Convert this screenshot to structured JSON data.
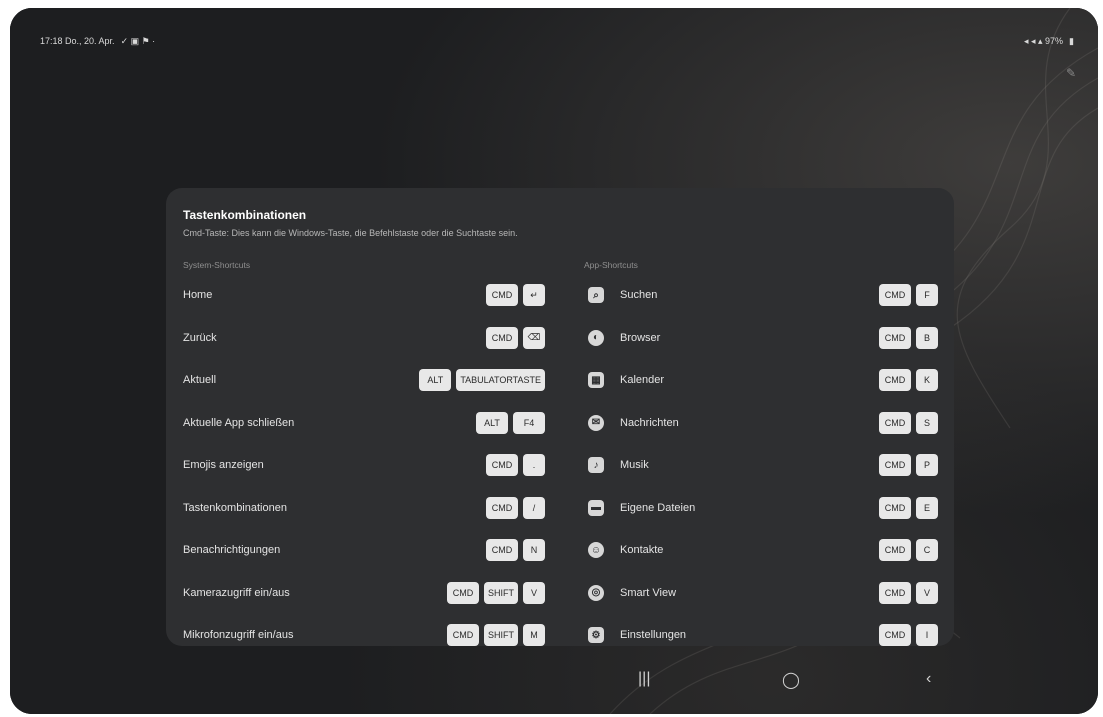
{
  "statusbar": {
    "time_date": "17:18 Do., 20. Apr.",
    "left_icons": "✓ ▣ ⚑ ·",
    "right_icons": "◂ ◂ ▴ 97%",
    "battery": "▮"
  },
  "dialog": {
    "title": "Tastenkombinationen",
    "subtitle": "Cmd-Taste: Dies kann die Windows-Taste, die Befehlstaste oder die Suchtaste sein.",
    "left_header": "System-Shortcuts",
    "right_header": "App-Shortcuts",
    "left_items": [
      {
        "label": "Home",
        "keys": [
          "CMD",
          "↵"
        ]
      },
      {
        "label": "Zurück",
        "keys": [
          "CMD",
          "⌫"
        ]
      },
      {
        "label": "Aktuell",
        "keys": [
          "ALT",
          "TABULATORTASTE"
        ]
      },
      {
        "label": "Aktuelle App schließen",
        "keys": [
          "ALT",
          "F4"
        ]
      },
      {
        "label": "Emojis anzeigen",
        "keys": [
          "CMD",
          "."
        ]
      },
      {
        "label": "Tastenkombinationen",
        "keys": [
          "CMD",
          "/"
        ]
      },
      {
        "label": "Benachrichtigungen",
        "keys": [
          "CMD",
          "N"
        ]
      },
      {
        "label": "Kamerazugriff ein/aus",
        "keys": [
          "CMD",
          "SHIFT",
          "V"
        ]
      },
      {
        "label": "Mikrofonzugriff ein/aus",
        "keys": [
          "CMD",
          "SHIFT",
          "M"
        ]
      }
    ],
    "right_items": [
      {
        "label": "Suchen",
        "icon": "search-app-icon",
        "glyph": "⌕",
        "keys": [
          "CMD",
          "F"
        ]
      },
      {
        "label": "Browser",
        "icon": "browser-app-icon",
        "glyph": "◐",
        "keys": [
          "CMD",
          "B"
        ]
      },
      {
        "label": "Kalender",
        "icon": "calendar-app-icon",
        "glyph": "▦",
        "keys": [
          "CMD",
          "K"
        ]
      },
      {
        "label": "Nachrichten",
        "icon": "messages-app-icon",
        "glyph": "✉",
        "keys": [
          "CMD",
          "S"
        ]
      },
      {
        "label": "Musik",
        "icon": "music-app-icon",
        "glyph": "♪",
        "keys": [
          "CMD",
          "P"
        ]
      },
      {
        "label": "Eigene Dateien",
        "icon": "files-app-icon",
        "glyph": "▬",
        "keys": [
          "CMD",
          "E"
        ]
      },
      {
        "label": "Kontakte",
        "icon": "contacts-app-icon",
        "glyph": "☺",
        "keys": [
          "CMD",
          "C"
        ]
      },
      {
        "label": "Smart View",
        "icon": "smartview-app-icon",
        "glyph": "◎",
        "keys": [
          "CMD",
          "V"
        ]
      },
      {
        "label": "Einstellungen",
        "icon": "settings-app-icon",
        "glyph": "⚙",
        "keys": [
          "CMD",
          "I"
        ]
      }
    ]
  },
  "navigation": {
    "recents": "|||",
    "home": "◯",
    "back": "‹"
  }
}
